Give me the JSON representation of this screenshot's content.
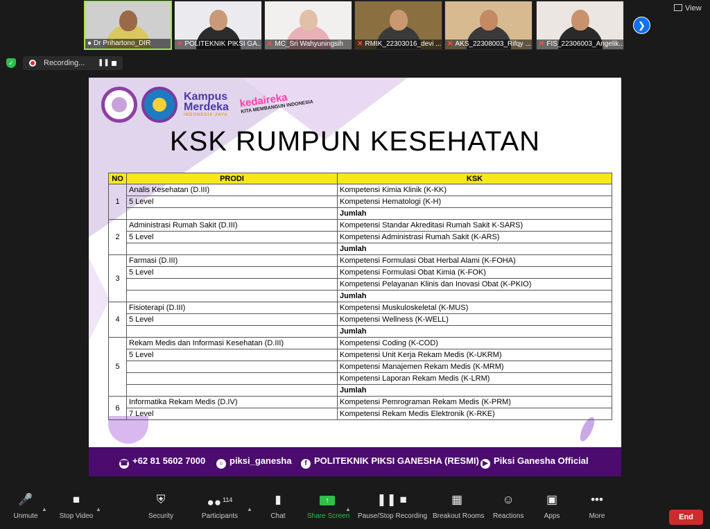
{
  "participants": [
    {
      "name": "Dr Prihartono_DIR",
      "skin": "#9a6a48",
      "bg": "#cfcfcf",
      "shirt": "#d9c860",
      "active": true,
      "muted": false
    },
    {
      "name": "POLITEKNIK PIKSI GA...",
      "skin": "#c89a78",
      "bg": "#ebebef",
      "shirt": "#2b2b2b",
      "active": false,
      "muted": true
    },
    {
      "name": "MC_Sri Wahyuningsih",
      "skin": "#e0c0a8",
      "bg": "#f2efef",
      "shirt": "#eab0b8",
      "active": false,
      "muted": true
    },
    {
      "name": "RMIK_22303016_devi ...",
      "skin": "#c99870",
      "bg": "#8a7040",
      "shirt": "#3a3a3a",
      "active": false,
      "muted": true
    },
    {
      "name": "AKS_22308003_Rifqy ...",
      "skin": "#c48a64",
      "bg": "#d8ba90",
      "shirt": "#3a3a3a",
      "active": false,
      "muted": true
    },
    {
      "name": "FIS_22306003_Angelik...",
      "skin": "#c8936c",
      "bg": "#ece6e2",
      "shirt": "#2a2a2a",
      "active": false,
      "muted": true
    }
  ],
  "view_label": "View",
  "recording_label": "Recording...",
  "slide": {
    "title": "KSK RUMPUN KESEHATAN",
    "kampus_line1": "Kampus",
    "kampus_line2": "Merdeka",
    "kampus_tag": "INDONESIA JAYA",
    "kedaireka": "kedaireka",
    "kedaireka_tag": "KITA MEMBANGUN INDONESIA",
    "headers": {
      "no": "NO",
      "prodi": "PRODI",
      "ksk": "KSK"
    },
    "groups": [
      {
        "no": "1",
        "prodi": [
          "Analis Kesehatan (D.III)",
          "5 Level"
        ],
        "ksk": [
          "Kompetensi Kimia Klinik (K-KK)",
          "Kompetensi Hematologi (K-H)"
        ],
        "total": "Jumlah"
      },
      {
        "no": "2",
        "prodi": [
          "Administrasi Rumah Sakit (D.III)",
          "5 Level"
        ],
        "ksk": [
          "Kompetensi  Standar Akreditasi Rumah Sakit K-SARS)",
          "Kompetensi  Administrasi Rumah Sakit (K-ARS)"
        ],
        "total": "Jumlah"
      },
      {
        "no": "3",
        "prodi": [
          "Farmasi (D.III)",
          "5 Level"
        ],
        "ksk": [
          "Kompetensi  Formulasi Obat Herbal Alami (K-FOHA)",
          "Kompetensi  Formulasi Obat Kimia (K-FOK)",
          "Kompetensi  Pelayanan Klinis dan Inovasi Obat (K-PKIO)"
        ],
        "total": "Jumlah"
      },
      {
        "no": "4",
        "prodi": [
          "Fisioterapi (D.III)",
          "5 Level"
        ],
        "ksk": [
          "Kompetensi  Muskuloskeletal (K-MUS)",
          "Kompetensi  Wellness (K-WELL)"
        ],
        "total": "Jumlah"
      },
      {
        "no": "5",
        "prodi": [
          "Rekam Medis dan Informasi Kesehatan (D.III)",
          "5 Level"
        ],
        "ksk": [
          "Kompetensi  Coding (K-COD)",
          "Kompetensi  Unit Kerja Rekam Medis (K-UKRM)",
          "Kompetensi  Manajemen Rekam Medis (K-MRM)",
          "Kompetensi  Laporan Rekam Medis (K-LRM)"
        ],
        "total": "Jumlah"
      },
      {
        "no": "6",
        "prodi": [
          "Informatika Rekam Medis (D.IV)",
          "7  Level"
        ],
        "ksk": [
          "Kompetensi  Pemrograman Rekam Medis (K-PRM)",
          "Kompetensi  Rekam Medis Elektronik (K-RKE)"
        ],
        "total": null
      }
    ],
    "footer": {
      "phone": "+62 81 5602 7000",
      "instagram": "piksi_ganesha",
      "facebook": "POLITEKNIK PIKSI GANESHA (RESMI)",
      "youtube": "Piksi Ganesha Official"
    }
  },
  "toolbar": {
    "unmute": "Unmute",
    "stop_video": "Stop Video",
    "security": "Security",
    "participants": "Participants",
    "participants_count": "114",
    "chat": "Chat",
    "share_screen": "Share Screen",
    "pause_recording": "Pause/Stop Recording",
    "breakout": "Breakout Rooms",
    "reactions": "Reactions",
    "apps": "Apps",
    "more": "More",
    "end": "End"
  },
  "colors": {
    "accent_blue": "#0e72ed",
    "share_green": "#2ec048",
    "end_red": "#cc2c2c",
    "header_yellow": "#f7e81a",
    "footer_purple": "#4b0c6e"
  }
}
